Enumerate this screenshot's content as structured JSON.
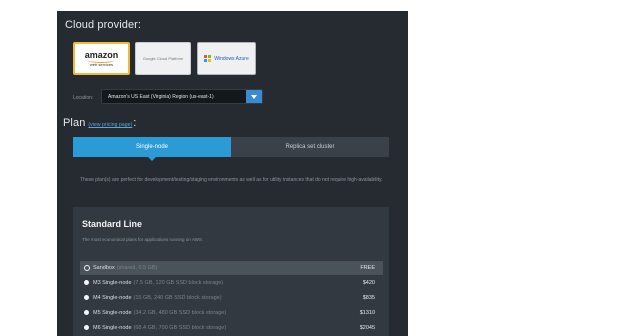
{
  "cloud_provider": {
    "heading": "Cloud provider:",
    "providers": [
      {
        "name": "Amazon Web Services",
        "logo_word": "amazon",
        "logo_sub": "web services",
        "selected": true
      },
      {
        "name": "Google Cloud Platform",
        "logo_text": "Google Cloud Platform",
        "selected": false
      },
      {
        "name": "Windows Azure",
        "logo_text": "Windows Azure",
        "selected": false
      }
    ],
    "location_label": "Location:",
    "location_value": "Amazon's US East (Virginia) Region (us-east-1)"
  },
  "plan": {
    "heading": "Plan",
    "pricing_link": "(view pricing page)",
    "heading_suffix": ":",
    "tabs": [
      {
        "label": "Single-node",
        "active": true
      },
      {
        "label": "Replica set cluster",
        "active": false
      }
    ],
    "description": "These plan(s) are perfect for development/testing/staging environments as well as for utility instances that do not require high-availability.",
    "standard_line": {
      "title": "Standard Line",
      "subtitle": "The most economical plans for applications running on AWS.",
      "rows": [
        {
          "name": "Sandbox",
          "spec": "(shared, 0.5 GB)",
          "price": "FREE",
          "selected": true
        },
        {
          "name": "M3 Single-node",
          "spec": "(7.5 GB, 120 GB SSD block storage)",
          "price": "$420",
          "selected": false
        },
        {
          "name": "M4 Single-node",
          "spec": "(15 GB, 240 GB SSD block storage)",
          "price": "$835",
          "selected": false
        },
        {
          "name": "M5 Single-node",
          "spec": "(34.2 GB, 480 GB SSD block storage)",
          "price": "$1310",
          "selected": false
        },
        {
          "name": "M6 Single-node",
          "spec": "(68.4 GB, 700 GB SSD block storage)",
          "price": "$2045",
          "selected": false
        }
      ]
    }
  },
  "colors": {
    "panel_bg": "#252b31",
    "accent_blue": "#2b9bd6",
    "amazon_orange": "#f0b93a"
  }
}
